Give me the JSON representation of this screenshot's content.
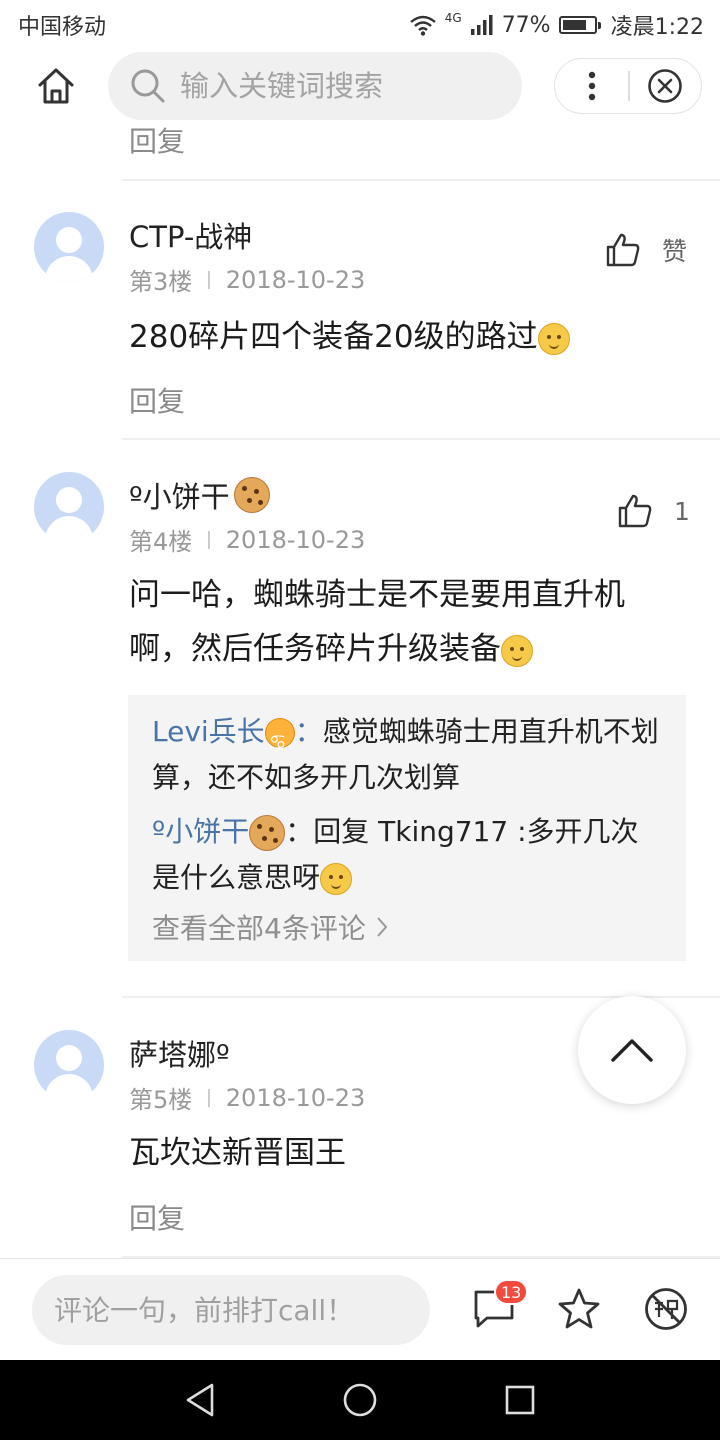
{
  "status_bar": {
    "carrier": "中国移动",
    "network": "4G",
    "battery_percent": "77%",
    "battery_level": 0.77,
    "time": "凌晨1:22"
  },
  "top_nav": {
    "search_placeholder": "输入关键词搜索",
    "icons": [
      "home-icon",
      "search-icon",
      "more-icon",
      "close-icon"
    ]
  },
  "reply_label": "回复",
  "comments": [
    {
      "username": "CTP-战神",
      "floor": "第3楼",
      "date": "2018-10-23",
      "text": "280碎片四个装备20级的路过",
      "like_label": "赞",
      "avatar": "default-avatar"
    },
    {
      "username": "º小饼干",
      "floor": "第4楼",
      "date": "2018-10-23",
      "text": "问一哈，蜘蛛骑士是不是要用直升机啊，然后任务碎片升级装备",
      "like_count": "1",
      "avatar": "default-avatar",
      "sub_replies": [
        {
          "name": "Levi兵长",
          "sep": "：",
          "text": "感觉蜘蛛骑士用直升机不划算，还不如多开几次划算"
        },
        {
          "name": "º小饼干",
          "sep": "：",
          "text": "回复 Tking717 :多开几次是什么意思呀"
        }
      ],
      "view_all": "查看全部4条评论"
    },
    {
      "username": "萨塔娜º",
      "floor": "第5楼",
      "date": "2018-10-23",
      "text": "瓦坎达新晋国王",
      "avatar": "default-avatar"
    }
  ],
  "bottom_bar": {
    "comment_placeholder": "评论一句，前排打call！",
    "comment_count_badge": "13",
    "icons": [
      "comment-icon",
      "star-icon",
      "barrage-off-icon"
    ]
  },
  "colors": {
    "accent_blue": "#4a74a8",
    "badge_red": "#f24a3d",
    "avatar_bg": "#c9daf6"
  }
}
